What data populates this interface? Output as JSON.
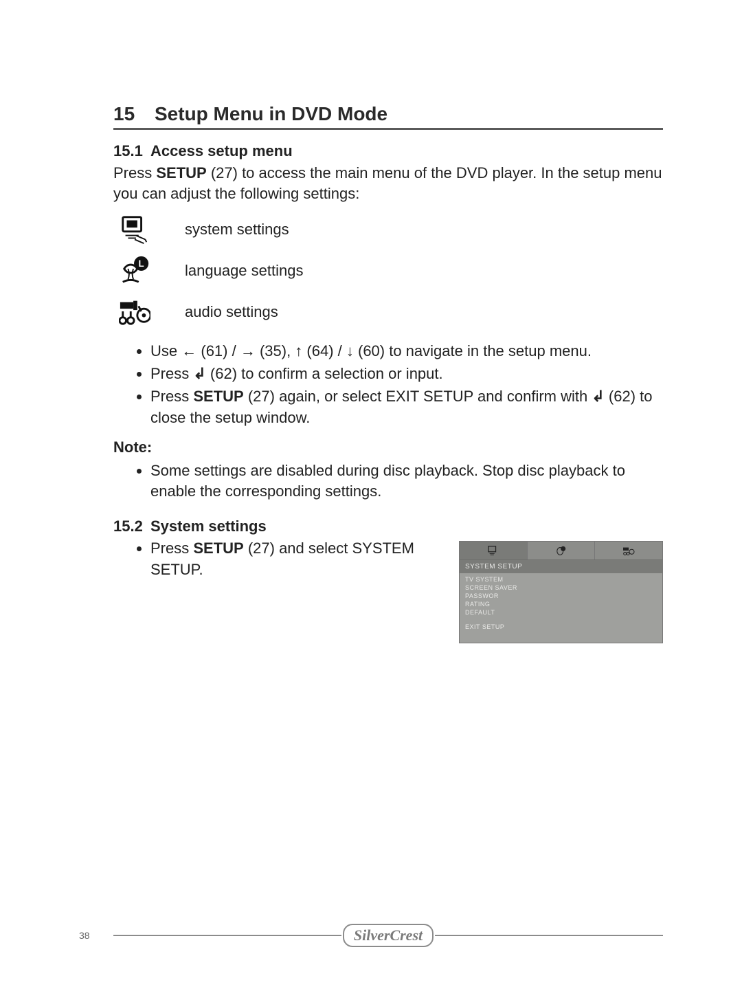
{
  "chapter": {
    "number": "15",
    "title": "Setup Menu in DVD Mode"
  },
  "s1": {
    "number": "15.1",
    "title": "Access setup menu",
    "intro_a": "Press ",
    "intro_bold": "SETUP",
    "intro_b": " (27) to access the main menu of the DVD player. In the setup menu you can adjust the following settings:",
    "icons": {
      "system": "system settings",
      "language": "language settings",
      "audio": "audio settings"
    },
    "nav_a": "Use ",
    "nav_b": " (61) / ",
    "nav_c": " (35), ",
    "nav_d": " (64) / ",
    "nav_e": " (60) to navigate in the setup menu.",
    "confirm_a": "Press ",
    "confirm_b": " (62) to confirm a selection or input.",
    "close_a": "Press ",
    "close_bold": "SETUP",
    "close_b": " (27) again, or select EXIT SETUP and confirm with ",
    "close_c": " (62) to close the setup window.",
    "note_label": "Note:",
    "note_text": "Some settings are disabled during disc playback. Stop disc playback to enable the corresponding settings."
  },
  "s2": {
    "number": "15.2",
    "title": "System settings",
    "bullet_a": "Press ",
    "bullet_bold": "SETUP",
    "bullet_b": " (27) and select SYSTEM SETUP."
  },
  "screenshot": {
    "title": "SYSTEM SETUP",
    "items": [
      "TV SYSTEM",
      "SCREEN SAVER",
      "PASSWOR",
      "RATING",
      "DEFAULT"
    ],
    "exit": "EXIT SETUP"
  },
  "arrows": {
    "left": "←",
    "right": "→",
    "up": "↑",
    "down": "↓",
    "enter": "↲"
  },
  "footer": {
    "page": "38",
    "brand": "SilverCrest"
  }
}
